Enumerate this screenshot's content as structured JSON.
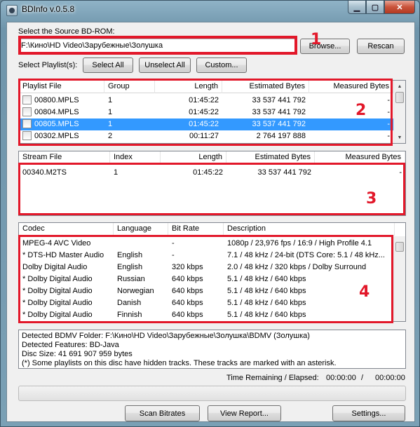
{
  "window": {
    "title": "BDInfo v.0.5.8",
    "close_glyph": "✕",
    "min_glyph": "▁",
    "max_glyph": "▢"
  },
  "source": {
    "label": "Select the Source BD-ROM:",
    "path": "F:\\Кино\\HD Video\\Зарубежные\\Золушка",
    "browse": "Browse...",
    "rescan": "Rescan"
  },
  "playlists": {
    "label": "Select Playlist(s):",
    "select_all": "Select All",
    "unselect_all": "Unselect All",
    "custom": "Custom...",
    "columns": [
      "Playlist File",
      "Group",
      "Length",
      "Estimated Bytes",
      "Measured Bytes"
    ],
    "rows": [
      {
        "file": "00800.MPLS",
        "group": "1",
        "length": "01:45:22",
        "est": "33 537 441 792",
        "meas": "-",
        "selected": false
      },
      {
        "file": "00804.MPLS",
        "group": "1",
        "length": "01:45:22",
        "est": "33 537 441 792",
        "meas": "-",
        "selected": false
      },
      {
        "file": "00805.MPLS",
        "group": "1",
        "length": "01:45:22",
        "est": "33 537 441 792",
        "meas": "-",
        "selected": true
      },
      {
        "file": "00302.MPLS",
        "group": "2",
        "length": "00:11:27",
        "est": "2 764 197 888",
        "meas": "-",
        "selected": false
      }
    ]
  },
  "streams": {
    "columns": [
      "Stream File",
      "Index",
      "Length",
      "Estimated Bytes",
      "Measured Bytes"
    ],
    "rows": [
      {
        "file": "00340.M2TS",
        "index": "1",
        "length": "01:45:22",
        "est": "33 537 441 792",
        "meas": "-"
      }
    ]
  },
  "codecs": {
    "columns": [
      "Codec",
      "Language",
      "Bit Rate",
      "Description"
    ],
    "rows": [
      {
        "codec": "MPEG-4 AVC Video",
        "lang": "",
        "bitrate": "-",
        "desc": "1080p / 23,976 fps / 16:9 / High Profile 4.1"
      },
      {
        "codec": "* DTS-HD Master Audio",
        "lang": "English",
        "bitrate": "-",
        "desc": "7.1 / 48 kHz / 24-bit (DTS Core: 5.1 / 48 kHz..."
      },
      {
        "codec": "Dolby Digital Audio",
        "lang": "English",
        "bitrate": "320 kbps",
        "desc": "2.0 / 48 kHz / 320 kbps / Dolby Surround"
      },
      {
        "codec": "* Dolby Digital Audio",
        "lang": "Russian",
        "bitrate": "640 kbps",
        "desc": "5.1 / 48 kHz / 640 kbps"
      },
      {
        "codec": "* Dolby Digital Audio",
        "lang": "Norwegian",
        "bitrate": "640 kbps",
        "desc": "5.1 / 48 kHz / 640 kbps"
      },
      {
        "codec": "* Dolby Digital Audio",
        "lang": "Danish",
        "bitrate": "640 kbps",
        "desc": "5.1 / 48 kHz / 640 kbps"
      },
      {
        "codec": "* Dolby Digital Audio",
        "lang": "Finnish",
        "bitrate": "640 kbps",
        "desc": "5.1 / 48 kHz / 640 kbps"
      }
    ]
  },
  "info": {
    "lines": [
      "Detected BDMV Folder: F:\\Кино\\HD Video\\Зарубежные\\Золушка\\BDMV (Золушка)",
      "Detected Features: BD-Java",
      "Disc Size: 41 691 907 959 bytes",
      "(*) Some playlists on this disc have hidden tracks. These tracks are marked with an asterisk."
    ]
  },
  "time": {
    "label": "Time Remaining / Elapsed:",
    "remaining": "00:00:00",
    "separator": "/",
    "elapsed": "00:00:00"
  },
  "progress": 0,
  "footer": {
    "scan": "Scan Bitrates",
    "report": "View Report...",
    "settings": "Settings..."
  },
  "annotations": {
    "n1": "1",
    "n2": "2",
    "n3": "3",
    "n4": "4",
    "color": "#e2182a"
  }
}
